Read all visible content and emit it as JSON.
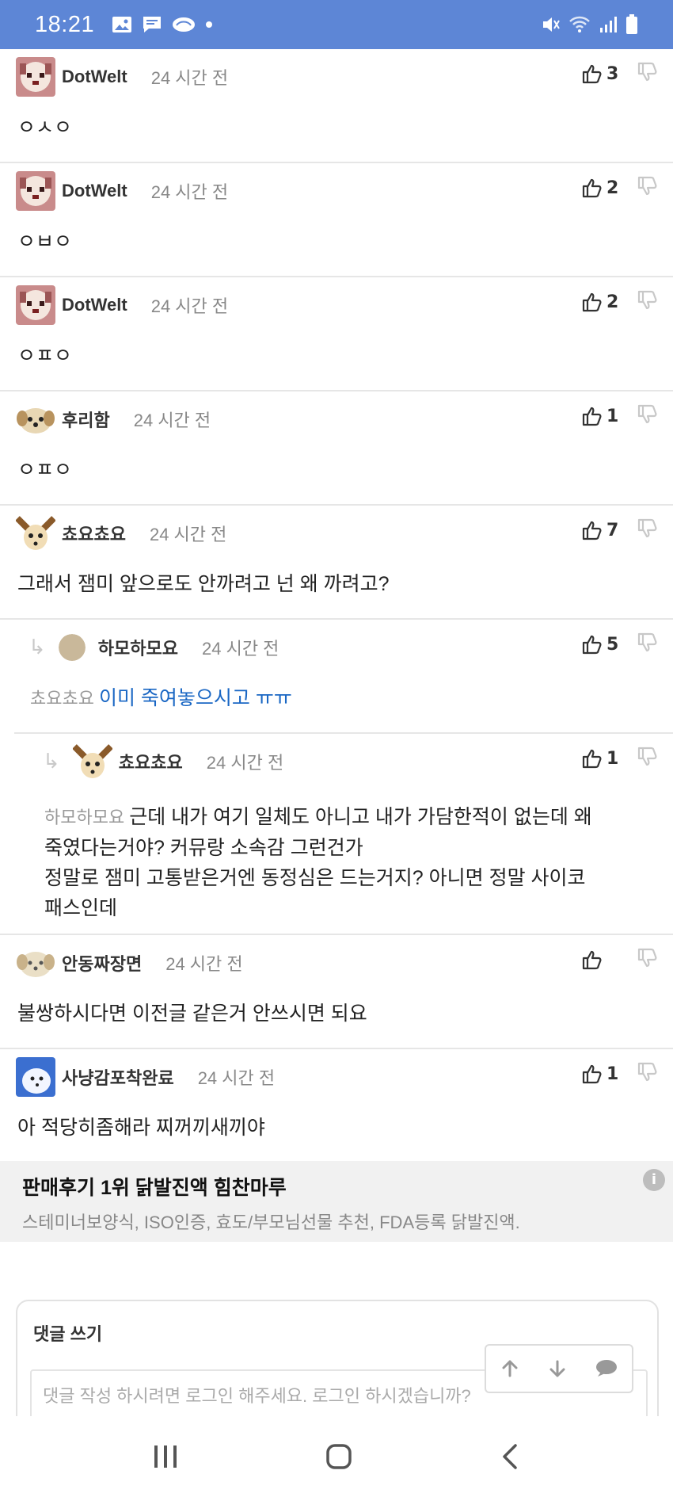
{
  "status_bar": {
    "time": "18:21",
    "left_icons": [
      "image-icon",
      "chat-icon",
      "cloud-icon",
      "dot-icon"
    ],
    "right_icons": [
      "mute-icon",
      "wifi-icon",
      "signal-icon",
      "battery-icon"
    ]
  },
  "comments": [
    {
      "nick": "DotWelt",
      "time": "24 시간 전",
      "likes": "3",
      "body": "ㅇㅅㅇ",
      "avatar": "dog-pixel"
    },
    {
      "nick": "DotWelt",
      "time": "24 시간 전",
      "likes": "2",
      "body": "ㅇㅂㅇ",
      "avatar": "dog-pixel"
    },
    {
      "nick": "DotWelt",
      "time": "24 시간 전",
      "likes": "2",
      "body": "ㅇㅍㅇ",
      "avatar": "dog-pixel"
    },
    {
      "nick": "후리함",
      "time": "24 시간 전",
      "likes": "1",
      "body": "ㅇㅍㅇ",
      "avatar": "puppy"
    },
    {
      "nick": "쵸요쵸요",
      "time": "24 시간 전",
      "likes": "7",
      "body": "그래서 잼미 앞으로도 안까려고 넌 왜 까려고?",
      "avatar": "chihuahua"
    },
    {
      "nick": "하모하모요",
      "time": "24 시간 전",
      "likes": "5",
      "mention": "쵸요쵸요",
      "body": "이미 죽여놓으시고 ㅠㅠ",
      "avatar": "circle"
    },
    {
      "nick": "쵸요쵸요",
      "time": "24 시간 전",
      "likes": "1",
      "mention": "하모하모요",
      "body": "근데 내가 여기 일체도 아니고 내가 가담한적이 없는데 왜",
      "body2": "죽였다는거야? 커뮤랑 소속감 그런건가",
      "body3": "정말로 잼미 고통받은거엔 동정심은 드는거지? 아니면 정말 사이코",
      "body4": "패스인데",
      "avatar": "chihuahua"
    },
    {
      "nick": "안동짜장면",
      "time": "24 시간 전",
      "likes": "",
      "body": "불쌍하시다면 이전글 같은거 안쓰시면 되요",
      "avatar": "puppy"
    },
    {
      "nick": "사냥감포착완료",
      "time": "24 시간 전",
      "likes": "1",
      "body": "아 적당히좀해라 찌꺼끼새끼야",
      "avatar": "blue"
    }
  ],
  "ad": {
    "title": "판매후기 1위 닭발진액 힘찬마루",
    "subtitle": "스테미너보양식, ISO인증, 효도/부모님선물 추천, FDA등록 닭발진액.",
    "info_icon": "info-icon"
  },
  "write_box": {
    "label": "댓글 쓰기",
    "placeholder": "댓글 작성 하시려면 로그인 해주세요. 로그인 하시겠습니까?"
  },
  "floating_nav": [
    "arrow-up-icon",
    "arrow-down-icon",
    "comment-icon"
  ],
  "nav_bar": [
    "recent-apps-icon",
    "home-icon",
    "back-icon"
  ],
  "colors": {
    "status_bar": "#5d86d6",
    "mention_link": "#1a67c4"
  }
}
